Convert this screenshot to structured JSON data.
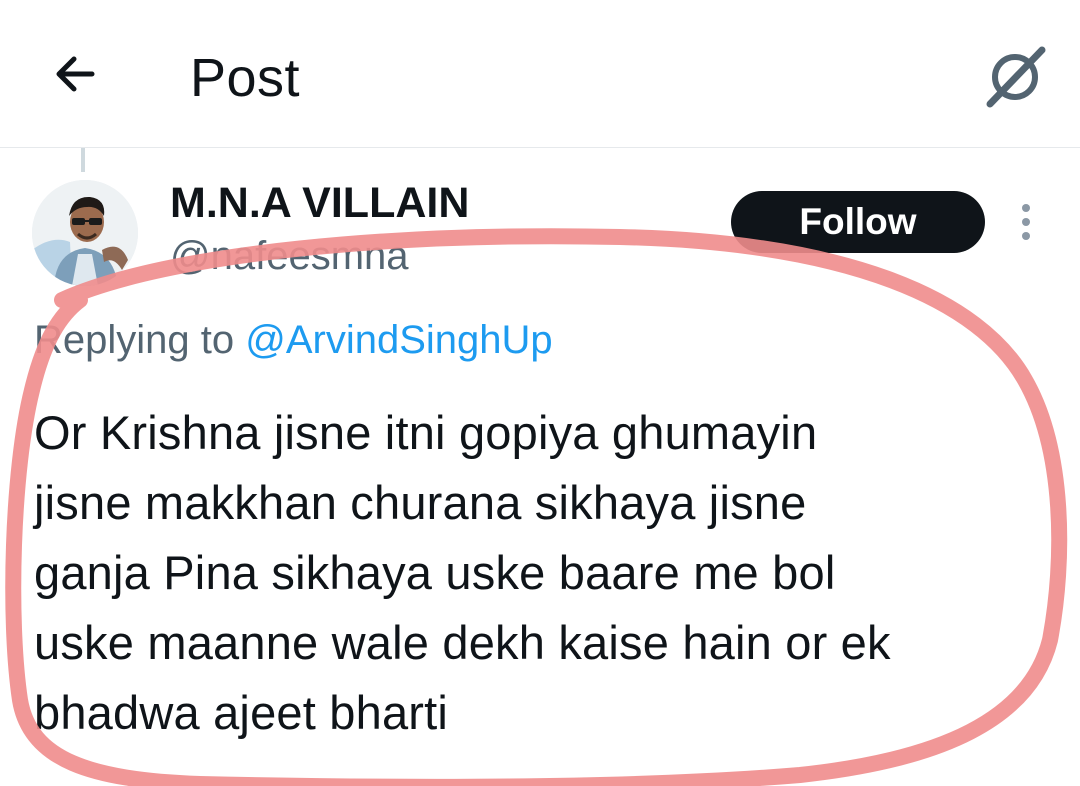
{
  "header": {
    "back_icon": "arrow-left-icon",
    "title": "Post",
    "grok_icon": "grok-slash-icon"
  },
  "post": {
    "author": {
      "display_name": "M.N.A VILLAIN",
      "handle": "@nafeesmna"
    },
    "follow_label": "Follow",
    "more_icon": "more-vertical-icon",
    "replying_prefix": "Replying to ",
    "replying_to": "@ArvindSinghUp",
    "text": "Or Krishna jisne itni gopiya ghumayin\njisne makkhan churana sikhaya jisne\nganja Pina sikhaya uske baare me bol\nuske maanne wale dekh kaise hain or ek\nbhadwa ajeet bharti"
  },
  "colors": {
    "follow_bg": "#0f1419",
    "link": "#1d9bf0",
    "secondary_text": "#536471",
    "annotation": "#f08c8c"
  }
}
